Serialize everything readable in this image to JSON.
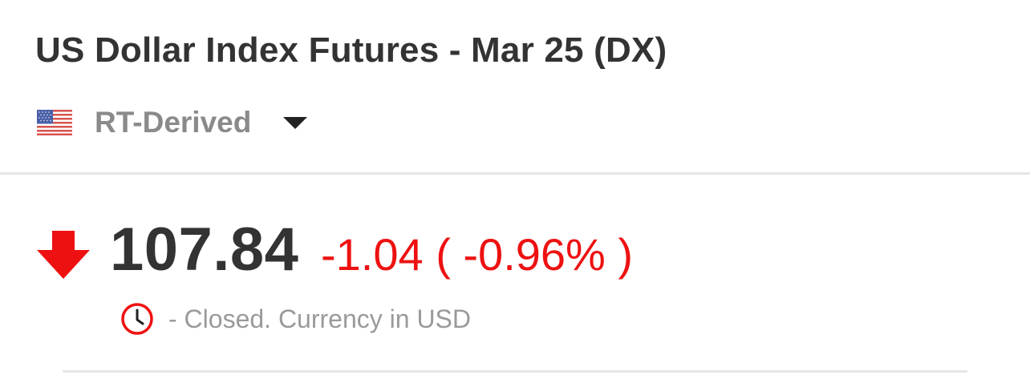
{
  "header": {
    "title": "US Dollar Index Futures - Mar 25 (DX)"
  },
  "source_selector": {
    "flag_icon": "us-flag-icon",
    "selected": "RT-Derived",
    "caret_icon": "caret-down-icon"
  },
  "quote": {
    "direction_icon": "down-arrow-icon",
    "direction_color": "#ee1111",
    "price": "107.84",
    "change": "-1.04 ( -0.96% )",
    "change_color": "#ee1111",
    "status_icon": "clock-icon",
    "status": "- Closed. Currency in USD"
  }
}
